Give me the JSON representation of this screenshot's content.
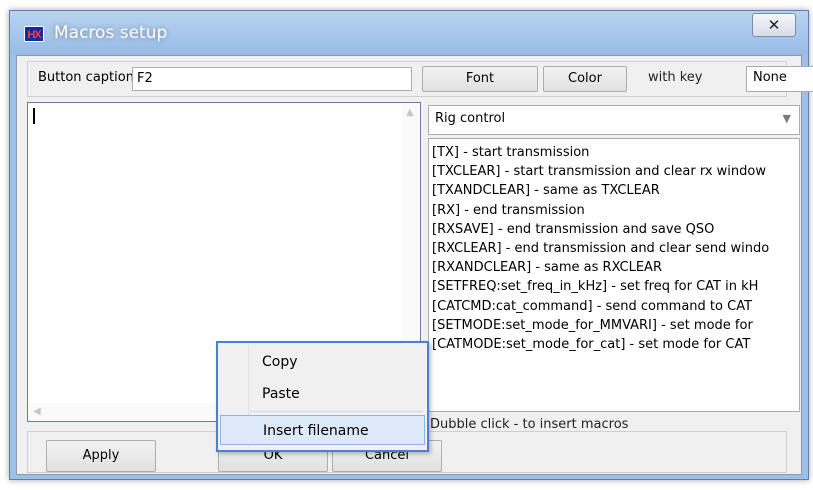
{
  "window": {
    "app_icon": "HX",
    "title": "Macros setup",
    "close_symbol": "✕"
  },
  "toolbar": {
    "caption_label": "Button caption",
    "caption_value": "F2",
    "font_button": "Font",
    "color_button": "Color",
    "with_key_label": "with key",
    "key_value": "None"
  },
  "editor": {
    "text": ""
  },
  "macros": {
    "category": "Rig control",
    "items": [
      "[TX] - start transmission",
      "[TXCLEAR] - start transmission and clear rx window",
      "[TXANDCLEAR] - same as TXCLEAR",
      "[RX] - end transmission",
      "[RXSAVE] - end transmission and save QSO",
      "[RXCLEAR] - end transmission and clear send windo",
      "[RXANDCLEAR] - same as RXCLEAR",
      "[SETFREQ:set_freq_in_kHz] - set freq for CAT in kH",
      "[CATCMD:cat_command] - send command to CAT",
      "[SETMODE:set_mode_for_MMVARI] - set mode for",
      "[CATMODE:set_mode_for_cat] - set mode for CAT"
    ],
    "hint": "Dubble click - to insert macros"
  },
  "buttons": {
    "apply": "Apply",
    "ok": "OK",
    "cancel": "Cancel"
  },
  "context_menu": {
    "copy": "Copy",
    "paste": "Paste",
    "insert_filename": "Insert filename"
  }
}
